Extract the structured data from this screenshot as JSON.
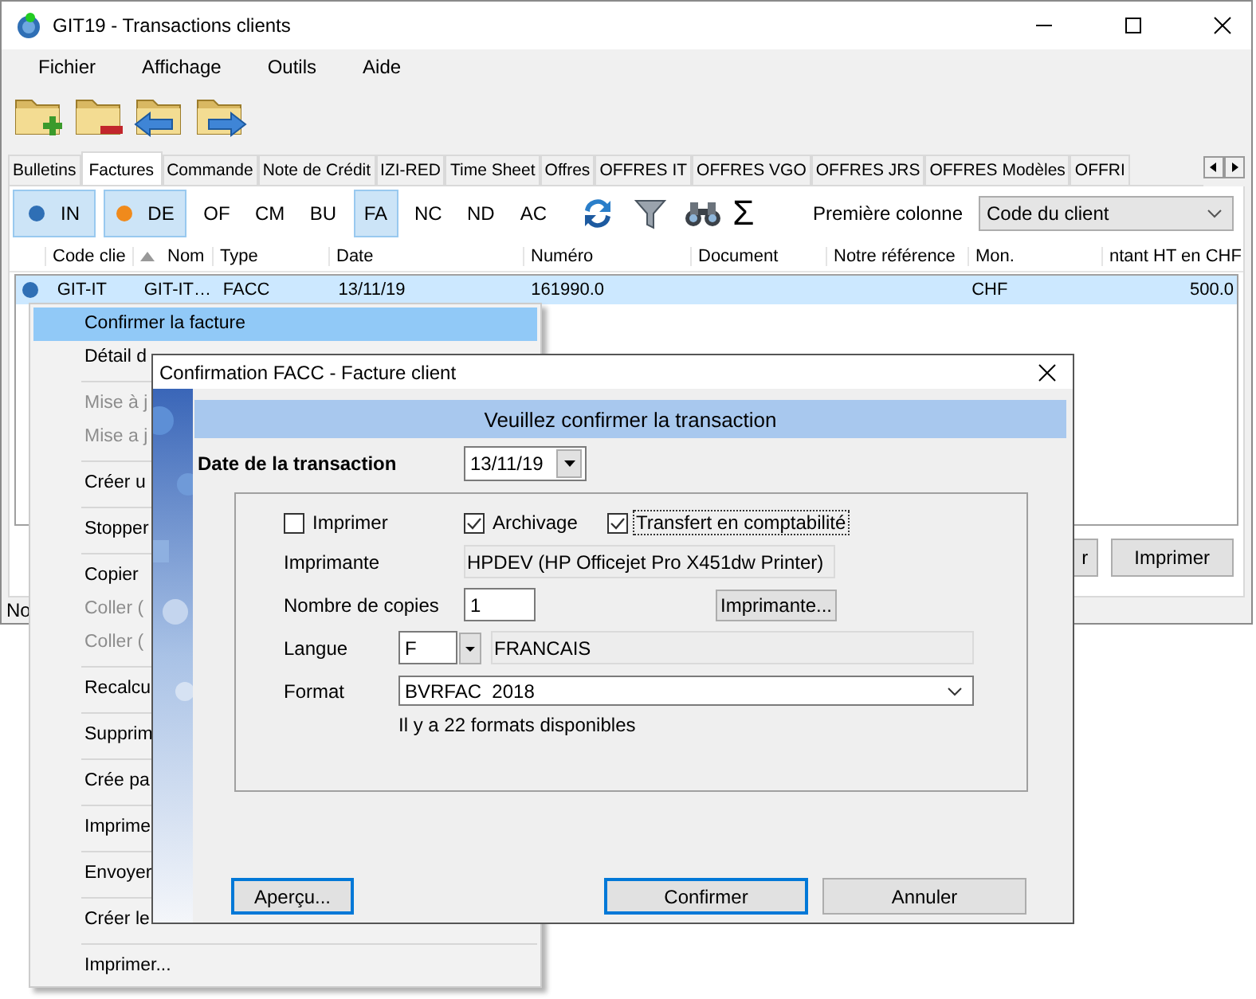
{
  "window": {
    "title": "GIT19 - Transactions clients"
  },
  "menu_bar": [
    "Fichier",
    "Affichage",
    "Outils",
    "Aide"
  ],
  "tabs": [
    {
      "label": "Bulletins",
      "selected": false
    },
    {
      "label": "Factures",
      "selected": true
    },
    {
      "label": "Commande",
      "selected": false
    },
    {
      "label": "Note de Crédit",
      "selected": false
    },
    {
      "label": "IZI-RED",
      "selected": false
    },
    {
      "label": "Time Sheet",
      "selected": false
    },
    {
      "label": "Offres",
      "selected": false
    },
    {
      "label": "OFFRES IT",
      "selected": false
    },
    {
      "label": "OFFRES VGO",
      "selected": false
    },
    {
      "label": "OFFRES JRS",
      "selected": false
    },
    {
      "label": "OFFRES Modèles",
      "selected": false
    },
    {
      "label": "OFFRI",
      "selected": false
    }
  ],
  "filters": [
    {
      "label": "IN",
      "selected": true,
      "color": "#2f6fb5"
    },
    {
      "label": "DE",
      "selected": true,
      "color": "#f08a1c"
    },
    {
      "label": "OF",
      "selected": false
    },
    {
      "label": "CM",
      "selected": false
    },
    {
      "label": "BU",
      "selected": false
    },
    {
      "label": "FA",
      "selected": true
    },
    {
      "label": "NC",
      "selected": false
    },
    {
      "label": "ND",
      "selected": false
    },
    {
      "label": "AC",
      "selected": false
    }
  ],
  "sum_symbol": "Σ",
  "first_column": {
    "label": "Première colonne",
    "value": "Code du client"
  },
  "table": {
    "columns": [
      {
        "label": "Code clie",
        "sorted": false
      },
      {
        "label": "Nom",
        "sorted": true
      },
      {
        "label": "Type",
        "sorted": false
      },
      {
        "label": "Date",
        "sorted": false
      },
      {
        "label": "Numéro",
        "sorted": false
      },
      {
        "label": "Document",
        "sorted": false
      },
      {
        "label": "Notre référence",
        "sorted": false
      },
      {
        "label": "Mon.",
        "sorted": false
      },
      {
        "label": "ntant HT en CHF",
        "sorted": false
      }
    ],
    "rows": [
      {
        "selected": true,
        "color": "#2f6fb5",
        "cells": [
          "GIT-IT",
          "GIT-IT…",
          "FACC",
          "13/11/19",
          "161990.0",
          "",
          "",
          "CHF",
          "500.0"
        ]
      }
    ]
  },
  "bottom_buttons": [
    "r",
    "Imprimer"
  ],
  "status_bar": "No",
  "context_menu": [
    [
      {
        "label": "Confirmer la facture",
        "selected": true,
        "disabled": false
      },
      {
        "label": "Détail d",
        "selected": false,
        "disabled": false
      }
    ],
    [
      {
        "label": "Mise à j",
        "selected": false,
        "disabled": true
      },
      {
        "label": "Mise a j",
        "selected": false,
        "disabled": true
      }
    ],
    [
      {
        "label": "Créer u",
        "selected": false,
        "disabled": false
      }
    ],
    [
      {
        "label": "Stopper",
        "selected": false,
        "disabled": false
      }
    ],
    [
      {
        "label": "Copier",
        "selected": false,
        "disabled": false
      },
      {
        "label": "Coller (",
        "selected": false,
        "disabled": true
      },
      {
        "label": "Coller (",
        "selected": false,
        "disabled": true
      }
    ],
    [
      {
        "label": "Recalcu",
        "selected": false,
        "disabled": false
      }
    ],
    [
      {
        "label": "Supprim",
        "selected": false,
        "disabled": false
      }
    ],
    [
      {
        "label": "Crée pa",
        "selected": false,
        "disabled": false
      }
    ],
    [
      {
        "label": "Imprime",
        "selected": false,
        "disabled": false
      }
    ],
    [
      {
        "label": "Envoyer",
        "selected": false,
        "disabled": false
      }
    ],
    [
      {
        "label": "Créer le",
        "selected": false,
        "disabled": false
      }
    ],
    [
      {
        "label": "Imprimer...",
        "selected": false,
        "disabled": false
      }
    ]
  ],
  "dialog": {
    "title": "Confirmation FACC - Facture client",
    "header": "Veuillez confirmer la transaction",
    "date_label": "Date de la transaction",
    "date_value": "13/11/19",
    "options": [
      {
        "label": "Imprimer",
        "checked": false,
        "focused": false
      },
      {
        "label": "Archivage",
        "checked": true,
        "focused": false
      },
      {
        "label": "Transfert en comptabilité",
        "checked": true,
        "focused": true
      }
    ],
    "printer_label": "Imprimante",
    "printer_value": "HPDEV (HP Officejet Pro X451dw Printer)",
    "copies_label": "Nombre de copies",
    "copies_value": "1",
    "printer_button": "Imprimante...",
    "language_label": "Langue",
    "language_code": "F",
    "language_name": "FRANCAIS",
    "format_label": "Format",
    "format_value": "BVRFAC  2018",
    "format_hint": "Il y a 22 formats disponibles",
    "buttons": [
      {
        "label": "Aperçu...",
        "highlighted": true
      },
      {
        "label": "Confirmer",
        "highlighted": true
      },
      {
        "label": "Annuler",
        "highlighted": false
      }
    ]
  }
}
